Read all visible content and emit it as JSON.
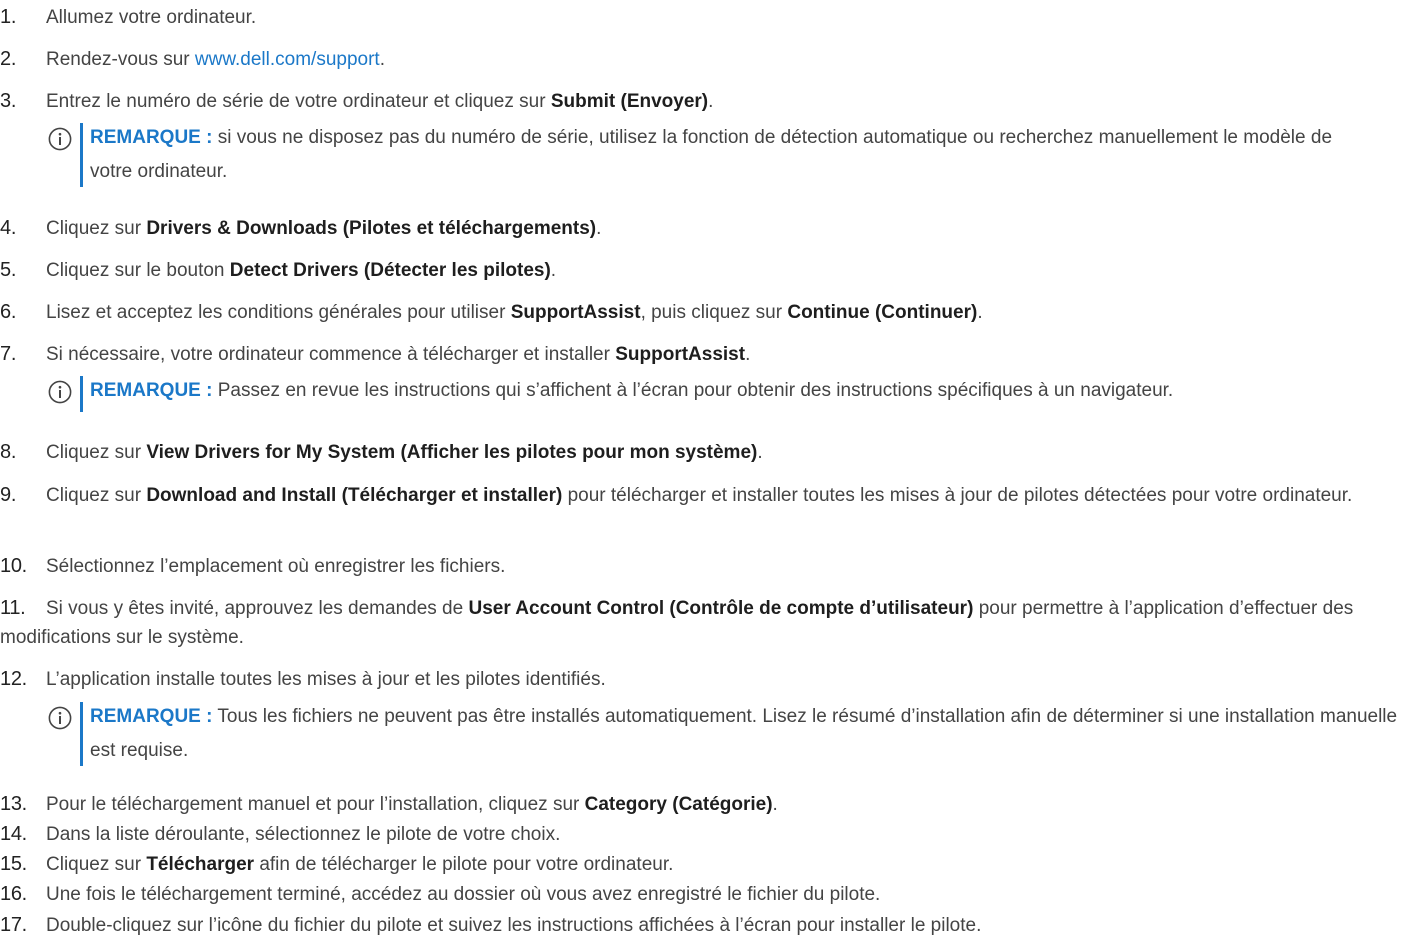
{
  "steps": [
    {
      "num": "1.",
      "parts": [
        {
          "t": "Allumez votre ordinateur."
        }
      ]
    },
    {
      "num": "2.",
      "parts": [
        {
          "t": "Rendez-vous sur "
        },
        {
          "t": "www.dell.com/support",
          "link": true
        },
        {
          "t": "."
        }
      ]
    },
    {
      "num": "3.",
      "parts": [
        {
          "t": "Entrez le numéro de série de votre ordinateur et cliquez sur "
        },
        {
          "t": "Submit (Envoyer)",
          "b": true
        },
        {
          "t": "."
        }
      ]
    },
    {
      "num": "4.",
      "parts": [
        {
          "t": "Cliquez sur "
        },
        {
          "t": "Drivers & Downloads (Pilotes et téléchargements)",
          "b": true
        },
        {
          "t": "."
        }
      ]
    },
    {
      "num": "5.",
      "parts": [
        {
          "t": "Cliquez sur le bouton "
        },
        {
          "t": "Detect Drivers (Détecter les pilotes)",
          "b": true
        },
        {
          "t": "."
        }
      ]
    },
    {
      "num": "6.",
      "parts": [
        {
          "t": "Lisez et acceptez les conditions générales pour utiliser "
        },
        {
          "t": "SupportAssist",
          "b": true
        },
        {
          "t": ", puis cliquez sur "
        },
        {
          "t": "Continue (Continuer)",
          "b": true
        },
        {
          "t": "."
        }
      ]
    },
    {
      "num": "7.",
      "parts": [
        {
          "t": "Si nécessaire, votre ordinateur commence à télécharger et installer "
        },
        {
          "t": "SupportAssist",
          "b": true
        },
        {
          "t": "."
        }
      ]
    },
    {
      "num": "8.",
      "parts": [
        {
          "t": "Cliquez sur "
        },
        {
          "t": "View Drivers for My System (Afficher les pilotes pour mon système)",
          "b": true
        },
        {
          "t": "."
        }
      ]
    },
    {
      "num": "9.",
      "parts": [
        {
          "t": "Cliquez sur "
        },
        {
          "t": "Download and Install (Télécharger et installer)",
          "b": true
        },
        {
          "t": " pour télécharger et installer toutes les mises à jour de pilotes détectées pour votre ordinateur."
        }
      ]
    },
    {
      "num": "10.",
      "parts": [
        {
          "t": "Sélectionnez l’emplacement où enregistrer les fichiers."
        }
      ]
    },
    {
      "num": "11.",
      "parts": [
        {
          "t": "Si vous y êtes invité, approuvez les demandes de "
        },
        {
          "t": "User Account Control (Contrôle de compte d’utilisateur)",
          "b": true
        },
        {
          "t": " pour permettre à l’application d’effectuer des modifications sur le système."
        }
      ]
    },
    {
      "num": "12.",
      "parts": [
        {
          "t": "L’application installe toutes les mises à jour et les pilotes identifiés."
        }
      ]
    },
    {
      "num": "13.",
      "parts": [
        {
          "t": "Pour le téléchargement manuel et pour l’installation, cliquez sur "
        },
        {
          "t": "Category (Catégorie)",
          "b": true
        },
        {
          "t": "."
        }
      ]
    },
    {
      "num": "14.",
      "parts": [
        {
          "t": "Dans la liste déroulante, sélectionnez le pilote de votre choix."
        }
      ]
    },
    {
      "num": "15.",
      "parts": [
        {
          "t": "Cliquez sur "
        },
        {
          "t": "Télécharger",
          "b": true
        },
        {
          "t": " afin de télécharger le pilote pour votre ordinateur."
        }
      ]
    },
    {
      "num": "16.",
      "parts": [
        {
          "t": "Une fois le téléchargement terminé, accédez au dossier où vous avez enregistré le fichier du pilote."
        }
      ]
    },
    {
      "num": "17.",
      "parts": [
        {
          "t": "Double-cliquez sur l’icône du fichier du pilote et suivez les instructions affichées à l’écran pour installer le pilote."
        }
      ]
    }
  ],
  "notes": [
    {
      "label": "REMARQUE :",
      "text": " si vous ne disposez pas du numéro de série, utilisez la fonction de détection automatique ou recherchez manuellement le modèle de votre ordinateur."
    },
    {
      "label": "REMARQUE :",
      "text": " Passez en revue les instructions qui s’affichent à l’écran pour obtenir des instructions spécifiques à un navigateur."
    },
    {
      "label": "REMARQUE :",
      "text": " Tous les fichiers ne peuvent pas être installés automatiquement. Lisez le résumé d’installation afin de déterminer si une installation manuelle est requise."
    }
  ],
  "colors": {
    "text": "#444444",
    "link": "#1b78c8",
    "note_accent": "#1b78c8"
  },
  "icons": {
    "note": "info-circle-icon"
  }
}
